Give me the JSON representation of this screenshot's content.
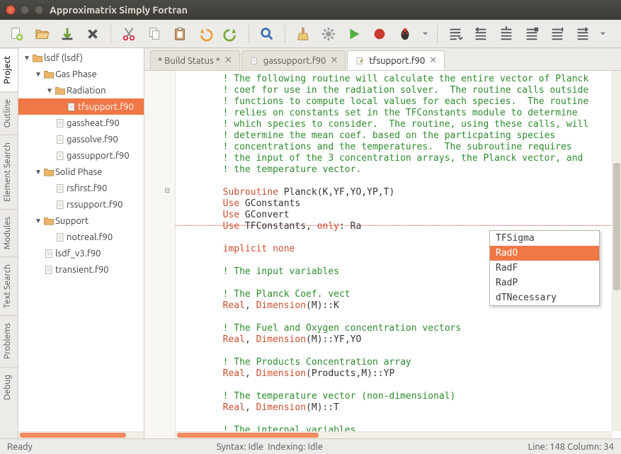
{
  "window": {
    "title": "Approximatrix Simply Fortran"
  },
  "sidetabs": [
    "Project",
    "Outline",
    "Element Search",
    "Modules",
    "Text Search",
    "Problems",
    "Debug"
  ],
  "tree": [
    {
      "depth": 0,
      "type": "folder",
      "expand": "down",
      "label": "lsdf (lsdf)",
      "sel": false
    },
    {
      "depth": 1,
      "type": "folder",
      "expand": "down",
      "label": "Gas Phase",
      "sel": false
    },
    {
      "depth": 2,
      "type": "folder",
      "expand": "down",
      "label": "Radiation",
      "sel": false
    },
    {
      "depth": 3,
      "type": "file",
      "expand": "",
      "label": "tfsupport.f90",
      "sel": true
    },
    {
      "depth": 2,
      "type": "file",
      "expand": "",
      "label": "gassheat.f90",
      "sel": false
    },
    {
      "depth": 2,
      "type": "file",
      "expand": "",
      "label": "gassolve.f90",
      "sel": false
    },
    {
      "depth": 2,
      "type": "file",
      "expand": "",
      "label": "gassupport.f90",
      "sel": false
    },
    {
      "depth": 1,
      "type": "folder",
      "expand": "down",
      "label": "Solid Phase",
      "sel": false
    },
    {
      "depth": 2,
      "type": "file",
      "expand": "",
      "label": "rsfirst.f90",
      "sel": false
    },
    {
      "depth": 2,
      "type": "file",
      "expand": "",
      "label": "rssupport.f90",
      "sel": false
    },
    {
      "depth": 1,
      "type": "folder",
      "expand": "down",
      "label": "Support",
      "sel": false
    },
    {
      "depth": 2,
      "type": "file",
      "expand": "",
      "label": "notreal.f90",
      "sel": false
    },
    {
      "depth": 1,
      "type": "file",
      "expand": "",
      "label": "lsdf_v3.f90",
      "sel": false
    },
    {
      "depth": 1,
      "type": "file",
      "expand": "",
      "label": "transient.f90",
      "sel": false
    }
  ],
  "tabs": [
    {
      "label": "* Build Status *",
      "active": false,
      "icon": "none"
    },
    {
      "label": "gassupport.f90",
      "active": false,
      "icon": "file"
    },
    {
      "label": "tfsupport.f90",
      "active": true,
      "icon": "file-edit"
    }
  ],
  "code_lines": [
    {
      "indent": "        ",
      "tokens": [
        {
          "t": "! The following routine will calculate the entire vector of Planck",
          "c": "c-comment"
        }
      ]
    },
    {
      "indent": "        ",
      "tokens": [
        {
          "t": "! coef for use in the radiation solver.  The routine calls outside",
          "c": "c-comment"
        }
      ]
    },
    {
      "indent": "        ",
      "tokens": [
        {
          "t": "! functions to compute local values for each species.  The routine",
          "c": "c-comment"
        }
      ]
    },
    {
      "indent": "        ",
      "tokens": [
        {
          "t": "! relies on constants set in the TFConstants module to determine",
          "c": "c-comment"
        }
      ]
    },
    {
      "indent": "        ",
      "tokens": [
        {
          "t": "! which species to consider.  The routine, using these calls, will",
          "c": "c-comment"
        }
      ]
    },
    {
      "indent": "        ",
      "tokens": [
        {
          "t": "! determine the mean coef. based on the particpating species",
          "c": "c-comment"
        }
      ]
    },
    {
      "indent": "        ",
      "tokens": [
        {
          "t": "! concentrations and the temperatures.  The subroutine requires",
          "c": "c-comment"
        }
      ]
    },
    {
      "indent": "        ",
      "tokens": [
        {
          "t": "! the input of the 3 concentration arrays, the Planck vector, and",
          "c": "c-comment"
        }
      ]
    },
    {
      "indent": "        ",
      "tokens": [
        {
          "t": "! the temperature vector.",
          "c": "c-comment"
        }
      ]
    },
    {
      "indent": "",
      "tokens": [
        {
          "t": "",
          "c": ""
        }
      ]
    },
    {
      "indent": "        ",
      "tokens": [
        {
          "t": "Subroutine",
          "c": "c-kw"
        },
        {
          "t": " Planck(K,YF,YO,YP,T)",
          "c": "c-ident"
        }
      ]
    },
    {
      "indent": "        ",
      "tokens": [
        {
          "t": "Use",
          "c": "c-kw"
        },
        {
          "t": " GConstants",
          "c": "c-ident"
        }
      ]
    },
    {
      "indent": "        ",
      "tokens": [
        {
          "t": "Use",
          "c": "c-kw"
        },
        {
          "t": " GConvert",
          "c": "c-ident"
        }
      ]
    },
    {
      "indent": "        ",
      "tokens": [
        {
          "t": "Use",
          "c": "c-kw"
        },
        {
          "t": " TFConstants, ",
          "c": "c-ident"
        },
        {
          "t": "only",
          "c": "c-kw2"
        },
        {
          "t": ": Ra",
          "c": "c-ident"
        }
      ]
    },
    {
      "indent": "",
      "tokens": [
        {
          "t": "",
          "c": ""
        }
      ]
    },
    {
      "indent": "        ",
      "tokens": [
        {
          "t": "implicit none",
          "c": "c-kw"
        }
      ]
    },
    {
      "indent": "",
      "tokens": [
        {
          "t": "",
          "c": ""
        }
      ]
    },
    {
      "indent": "        ",
      "tokens": [
        {
          "t": "! The input variables",
          "c": "c-comment"
        }
      ]
    },
    {
      "indent": "",
      "tokens": [
        {
          "t": "",
          "c": ""
        }
      ]
    },
    {
      "indent": "        ",
      "tokens": [
        {
          "t": "! The Planck Coef. vect",
          "c": "c-comment"
        }
      ]
    },
    {
      "indent": "        ",
      "tokens": [
        {
          "t": "Real",
          "c": "c-kw"
        },
        {
          "t": ", ",
          "c": "c-ident"
        },
        {
          "t": "Dimension",
          "c": "c-kw"
        },
        {
          "t": "(M)::K",
          "c": "c-ident"
        }
      ]
    },
    {
      "indent": "",
      "tokens": [
        {
          "t": "",
          "c": ""
        }
      ]
    },
    {
      "indent": "        ",
      "tokens": [
        {
          "t": "! The Fuel and Oxygen concentration vectors",
          "c": "c-comment"
        }
      ]
    },
    {
      "indent": "        ",
      "tokens": [
        {
          "t": "Real",
          "c": "c-kw"
        },
        {
          "t": ", ",
          "c": "c-ident"
        },
        {
          "t": "Dimension",
          "c": "c-kw"
        },
        {
          "t": "(M)::YF,YO",
          "c": "c-ident"
        }
      ]
    },
    {
      "indent": "",
      "tokens": [
        {
          "t": "",
          "c": ""
        }
      ]
    },
    {
      "indent": "        ",
      "tokens": [
        {
          "t": "! The Products Concentration array",
          "c": "c-comment"
        }
      ]
    },
    {
      "indent": "        ",
      "tokens": [
        {
          "t": "Real",
          "c": "c-kw"
        },
        {
          "t": ", ",
          "c": "c-ident"
        },
        {
          "t": "Dimension",
          "c": "c-kw"
        },
        {
          "t": "(Products,M)::YP",
          "c": "c-ident"
        }
      ]
    },
    {
      "indent": "",
      "tokens": [
        {
          "t": "",
          "c": ""
        }
      ]
    },
    {
      "indent": "        ",
      "tokens": [
        {
          "t": "! The temperature vector (non-dimensional)",
          "c": "c-comment"
        }
      ]
    },
    {
      "indent": "        ",
      "tokens": [
        {
          "t": "Real",
          "c": "c-kw"
        },
        {
          "t": ", ",
          "c": "c-ident"
        },
        {
          "t": "Dimension",
          "c": "c-kw"
        },
        {
          "t": "(M)::T",
          "c": "c-ident"
        }
      ]
    },
    {
      "indent": "",
      "tokens": [
        {
          "t": "",
          "c": ""
        }
      ]
    },
    {
      "indent": "        ",
      "tokens": [
        {
          "t": "! The internal variables",
          "c": "c-comment"
        }
      ]
    }
  ],
  "autocomplete": {
    "items": [
      "TFSigma",
      "RadO",
      "RadF",
      "RadP",
      "dTNecessary"
    ],
    "selected": 1
  },
  "status": {
    "ready": "Ready",
    "syntax": "Syntax: Idle",
    "indexing": "Indexing: Idle",
    "pos": "Line: 148 Column: 34"
  }
}
